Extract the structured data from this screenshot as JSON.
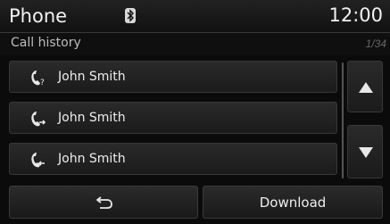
{
  "header": {
    "title": "Phone",
    "time": "12:00",
    "bluetooth_icon": "bluetooth-icon"
  },
  "subheader": {
    "title": "Call history",
    "page_indicator": "1/34"
  },
  "call_history": [
    {
      "name": "John Smith",
      "icon": "missed-call-icon"
    },
    {
      "name": "John Smith",
      "icon": "outgoing-call-icon"
    },
    {
      "name": "John Smith",
      "icon": "incoming-call-icon"
    }
  ],
  "scroll": {
    "up_icon": "arrow-up-icon",
    "down_icon": "arrow-down-icon"
  },
  "bottom": {
    "back_icon": "back-arrow-icon",
    "download_label": "Download"
  }
}
